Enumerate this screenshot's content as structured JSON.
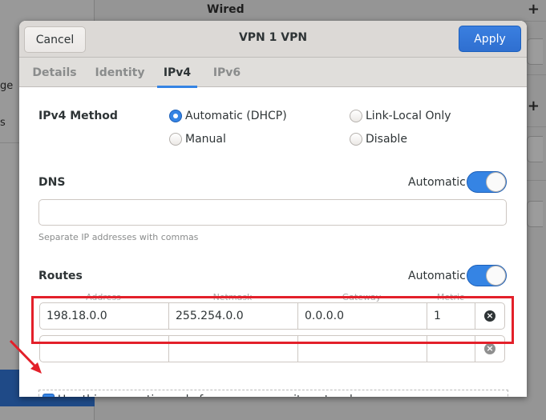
{
  "background": {
    "sidebar_fragments": [
      "ge",
      "s"
    ],
    "header_title": "Wired",
    "plus_icon": "plus-icon"
  },
  "dialog": {
    "title": "VPN 1 VPN",
    "cancel_label": "Cancel",
    "apply_label": "Apply",
    "tabs": [
      {
        "label": "Details",
        "active": false
      },
      {
        "label": "Identity",
        "active": false
      },
      {
        "label": "IPv4",
        "active": true
      },
      {
        "label": "IPv6",
        "active": false
      }
    ]
  },
  "ipv4": {
    "method_label": "IPv4 Method",
    "methods": [
      {
        "label": "Automatic (DHCP)",
        "selected": true
      },
      {
        "label": "Link-Local Only",
        "selected": false
      },
      {
        "label": "Manual",
        "selected": false
      },
      {
        "label": "Disable",
        "selected": false
      }
    ],
    "dns": {
      "label": "DNS",
      "automatic_label": "Automatic",
      "automatic_on": true,
      "value": "",
      "hint": "Separate IP addresses with commas"
    },
    "routes": {
      "label": "Routes",
      "automatic_label": "Automatic",
      "automatic_on": true,
      "columns": [
        "Address",
        "Netmask",
        "Gateway",
        "Metric"
      ],
      "rows": [
        {
          "address": "198.18.0.0",
          "netmask": "255.254.0.0",
          "gateway": "0.0.0.0",
          "metric": "1"
        },
        {
          "address": "",
          "netmask": "",
          "gateway": "",
          "metric": ""
        }
      ]
    },
    "only_local_label": "Use this connection only for resources on its network",
    "only_local_checked": true
  },
  "annotation": {
    "highlight_color": "#e3202a"
  },
  "colors": {
    "accent": "#3584e4"
  }
}
